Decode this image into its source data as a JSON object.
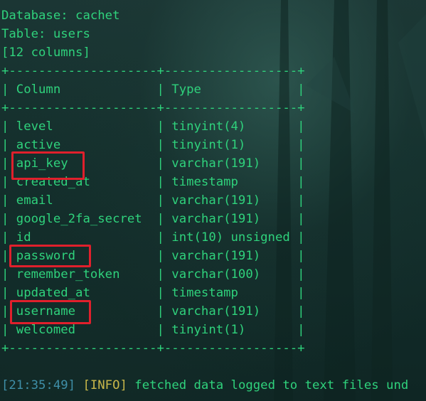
{
  "header": {
    "database_line": "Database: cachet",
    "table_line": "Table: users",
    "columns_line": "[12 columns]"
  },
  "table": {
    "border_line": "+--------------------+------------------+",
    "header_row": "| Column             | Type             |",
    "rows": [
      "| level              | tinyint(4)       |",
      "| active             | tinyint(1)       |",
      "| api_key            | varchar(191)     |",
      "| created_at         | timestamp        |",
      "| email              | varchar(191)     |",
      "| google_2fa_secret  | varchar(191)     |",
      "| id                 | int(10) unsigned |",
      "| password           | varchar(191)     |",
      "| remember_token     | varchar(100)     |",
      "| updated_at         | timestamp        |",
      "| username           | varchar(191)     |",
      "| welcomed           | tinyint(1)       |"
    ],
    "highlighted": [
      "api_key",
      "password",
      "username"
    ]
  },
  "log": {
    "timestamp": "21:35:49",
    "level": "INFO",
    "message": " fetched data logged to text files und"
  },
  "colors": {
    "text": "#2fd27c",
    "highlight_box": "#e0202c",
    "timestamp": "#3f8fa8",
    "level": "#c9b84a"
  }
}
